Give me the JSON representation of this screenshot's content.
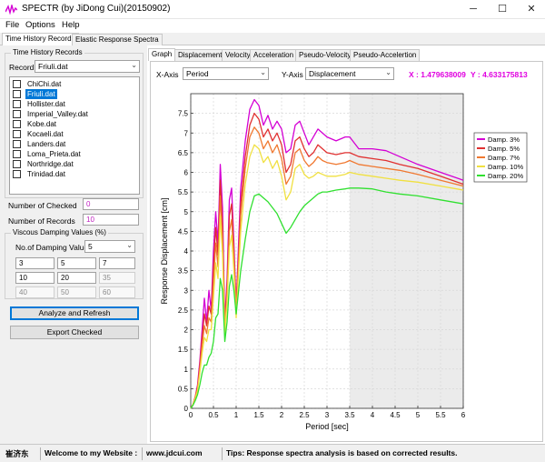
{
  "window": {
    "title": "SPECTR (by JiDong Cui)(20150902)",
    "minimize": "─",
    "maximize": "☐",
    "close": "✕"
  },
  "menu": [
    "File",
    "Options",
    "Help"
  ],
  "main_tabs": [
    "Time History Records",
    "Elastic Response Spectra"
  ],
  "left": {
    "group_title": "Time History Records",
    "record_label": "Record",
    "record_value": "Friuli.dat",
    "files": [
      "ChiChi.dat",
      "Friuli.dat",
      "Hollister.dat",
      "Imperial_Valley.dat",
      "Kobe.dat",
      "Kocaeli.dat",
      "Landers.dat",
      "Loma_Prieta.dat",
      "Northridge.dat",
      "Trinidad.dat"
    ],
    "selected_file_index": 1,
    "num_checked_label": "Number of Checked",
    "num_checked_value": "0",
    "num_records_label": "Number of Records",
    "num_records_value": "10",
    "damping_group_title": "Viscous Damping Values (%)",
    "num_damping_label": "No.of Damping Values",
    "num_damping_value": "5",
    "damping_inputs": [
      "3",
      "5",
      "7",
      "10",
      "20",
      "35",
      "40",
      "50",
      "60"
    ],
    "analyze_button": "Analyze and Refresh",
    "export_button": "Export Checked"
  },
  "graph_tabs": [
    "Graph",
    "Displacement",
    "Velocity",
    "Acceleration",
    "Pseudo-Velocity",
    "Pseudo-Accelertion"
  ],
  "axis_selectors": {
    "x_label": "X-Axis",
    "x_value": "Period",
    "y_label": "Y-Axis",
    "y_value": "Displacement"
  },
  "cursor": {
    "x": "X : 1.479638009",
    "y": "Y : 4.633175813"
  },
  "status": {
    "author": "崔济东",
    "welcome": "Welcome to my Website :",
    "website": "www.jdcui.com",
    "tips": "Tips: Response spectra analysis is based on corrected results."
  },
  "chart_data": {
    "type": "line",
    "xlabel": "Period [sec]",
    "ylabel": "Response Displacement [cm]",
    "xlim": [
      0,
      6
    ],
    "ylim": [
      0,
      8
    ],
    "xticks": [
      "0",
      "0.5",
      "1",
      "1.5",
      "2",
      "2.5",
      "3",
      "3.5",
      "4",
      "4.5",
      "5",
      "5.5",
      "6"
    ],
    "yticks": [
      "0",
      "0.5",
      "1",
      "1.5",
      "2",
      "2.5",
      "3",
      "3.5",
      "4",
      "4.5",
      "5",
      "5.5",
      "6",
      "6.5",
      "7",
      "7.5"
    ],
    "shaded_x_from": 3.5,
    "grid": true,
    "legend_position": "top-right",
    "series": [
      {
        "name": "Damp. 3%",
        "color": "#d400d4",
        "points": [
          [
            0,
            0
          ],
          [
            0.05,
            0.1
          ],
          [
            0.1,
            0.3
          ],
          [
            0.15,
            0.6
          ],
          [
            0.2,
            1.2
          ],
          [
            0.25,
            2.0
          ],
          [
            0.3,
            2.8
          ],
          [
            0.35,
            2.2
          ],
          [
            0.4,
            3.0
          ],
          [
            0.45,
            2.5
          ],
          [
            0.5,
            4.0
          ],
          [
            0.55,
            5.0
          ],
          [
            0.6,
            4.2
          ],
          [
            0.65,
            6.2
          ],
          [
            0.7,
            5.1
          ],
          [
            0.75,
            2.2
          ],
          [
            0.8,
            3.3
          ],
          [
            0.85,
            5.3
          ],
          [
            0.9,
            5.6
          ],
          [
            0.95,
            4.2
          ],
          [
            1.0,
            2.6
          ],
          [
            1.1,
            5.6
          ],
          [
            1.2,
            6.8
          ],
          [
            1.3,
            7.6
          ],
          [
            1.4,
            7.85
          ],
          [
            1.5,
            7.7
          ],
          [
            1.6,
            7.2
          ],
          [
            1.7,
            7.45
          ],
          [
            1.8,
            7.1
          ],
          [
            1.9,
            7.3
          ],
          [
            2.0,
            7.1
          ],
          [
            2.1,
            6.5
          ],
          [
            2.2,
            6.6
          ],
          [
            2.3,
            7.2
          ],
          [
            2.4,
            7.3
          ],
          [
            2.5,
            7.0
          ],
          [
            2.6,
            6.7
          ],
          [
            2.7,
            6.9
          ],
          [
            2.8,
            7.1
          ],
          [
            2.9,
            7.0
          ],
          [
            3.0,
            6.9
          ],
          [
            3.2,
            6.8
          ],
          [
            3.4,
            6.9
          ],
          [
            3.5,
            6.9
          ],
          [
            3.7,
            6.6
          ],
          [
            4.0,
            6.6
          ],
          [
            4.3,
            6.55
          ],
          [
            4.6,
            6.4
          ],
          [
            5.0,
            6.2
          ],
          [
            5.5,
            6.0
          ],
          [
            6.0,
            5.8
          ]
        ]
      },
      {
        "name": "Damp. 5%",
        "color": "#e03030",
        "points": [
          [
            0,
            0
          ],
          [
            0.05,
            0.1
          ],
          [
            0.1,
            0.3
          ],
          [
            0.15,
            0.55
          ],
          [
            0.2,
            1.1
          ],
          [
            0.25,
            1.8
          ],
          [
            0.3,
            2.4
          ],
          [
            0.35,
            2.1
          ],
          [
            0.4,
            2.6
          ],
          [
            0.45,
            2.4
          ],
          [
            0.5,
            3.6
          ],
          [
            0.55,
            4.6
          ],
          [
            0.6,
            3.9
          ],
          [
            0.65,
            5.8
          ],
          [
            0.7,
            4.6
          ],
          [
            0.75,
            2.1
          ],
          [
            0.8,
            3.1
          ],
          [
            0.85,
            4.9
          ],
          [
            0.9,
            5.2
          ],
          [
            0.95,
            4.0
          ],
          [
            1.0,
            2.5
          ],
          [
            1.1,
            5.2
          ],
          [
            1.2,
            6.4
          ],
          [
            1.3,
            7.2
          ],
          [
            1.4,
            7.5
          ],
          [
            1.5,
            7.35
          ],
          [
            1.6,
            6.9
          ],
          [
            1.7,
            7.1
          ],
          [
            1.8,
            6.8
          ],
          [
            1.9,
            7.0
          ],
          [
            2.0,
            6.7
          ],
          [
            2.1,
            6.0
          ],
          [
            2.2,
            6.2
          ],
          [
            2.3,
            6.8
          ],
          [
            2.4,
            6.9
          ],
          [
            2.5,
            6.6
          ],
          [
            2.6,
            6.4
          ],
          [
            2.7,
            6.5
          ],
          [
            2.8,
            6.7
          ],
          [
            2.9,
            6.6
          ],
          [
            3.0,
            6.5
          ],
          [
            3.2,
            6.45
          ],
          [
            3.4,
            6.5
          ],
          [
            3.5,
            6.5
          ],
          [
            3.7,
            6.4
          ],
          [
            4.0,
            6.35
          ],
          [
            4.3,
            6.3
          ],
          [
            4.6,
            6.2
          ],
          [
            5.0,
            6.1
          ],
          [
            5.5,
            5.9
          ],
          [
            6.0,
            5.7
          ]
        ]
      },
      {
        "name": "Damp. 7%",
        "color": "#f07830",
        "points": [
          [
            0,
            0
          ],
          [
            0.05,
            0.1
          ],
          [
            0.1,
            0.3
          ],
          [
            0.15,
            0.5
          ],
          [
            0.2,
            1.0
          ],
          [
            0.25,
            1.6
          ],
          [
            0.3,
            2.1
          ],
          [
            0.35,
            1.9
          ],
          [
            0.4,
            2.3
          ],
          [
            0.45,
            2.2
          ],
          [
            0.5,
            3.2
          ],
          [
            0.55,
            4.2
          ],
          [
            0.6,
            3.6
          ],
          [
            0.65,
            5.4
          ],
          [
            0.7,
            4.3
          ],
          [
            0.75,
            2.0
          ],
          [
            0.8,
            2.9
          ],
          [
            0.85,
            4.5
          ],
          [
            0.9,
            4.8
          ],
          [
            0.95,
            3.8
          ],
          [
            1.0,
            2.4
          ],
          [
            1.1,
            4.9
          ],
          [
            1.2,
            6.1
          ],
          [
            1.3,
            6.9
          ],
          [
            1.4,
            7.15
          ],
          [
            1.5,
            7.0
          ],
          [
            1.6,
            6.6
          ],
          [
            1.7,
            6.8
          ],
          [
            1.8,
            6.5
          ],
          [
            1.9,
            6.7
          ],
          [
            2.0,
            6.35
          ],
          [
            2.1,
            5.7
          ],
          [
            2.2,
            5.9
          ],
          [
            2.3,
            6.5
          ],
          [
            2.4,
            6.6
          ],
          [
            2.5,
            6.3
          ],
          [
            2.6,
            6.15
          ],
          [
            2.7,
            6.25
          ],
          [
            2.8,
            6.4
          ],
          [
            2.9,
            6.3
          ],
          [
            3.0,
            6.25
          ],
          [
            3.2,
            6.2
          ],
          [
            3.4,
            6.25
          ],
          [
            3.5,
            6.3
          ],
          [
            3.7,
            6.2
          ],
          [
            4.0,
            6.15
          ],
          [
            4.3,
            6.1
          ],
          [
            4.6,
            6.05
          ],
          [
            5.0,
            5.95
          ],
          [
            5.5,
            5.8
          ],
          [
            6.0,
            5.65
          ]
        ]
      },
      {
        "name": "Damp. 10%",
        "color": "#f0e040",
        "points": [
          [
            0,
            0
          ],
          [
            0.05,
            0.1
          ],
          [
            0.1,
            0.25
          ],
          [
            0.15,
            0.45
          ],
          [
            0.2,
            0.9
          ],
          [
            0.25,
            1.4
          ],
          [
            0.3,
            1.8
          ],
          [
            0.35,
            1.7
          ],
          [
            0.4,
            2.0
          ],
          [
            0.45,
            2.0
          ],
          [
            0.5,
            2.8
          ],
          [
            0.55,
            3.7
          ],
          [
            0.6,
            3.3
          ],
          [
            0.65,
            4.9
          ],
          [
            0.7,
            3.9
          ],
          [
            0.75,
            1.9
          ],
          [
            0.8,
            2.7
          ],
          [
            0.85,
            4.1
          ],
          [
            0.9,
            4.4
          ],
          [
            0.95,
            3.5
          ],
          [
            1.0,
            2.3
          ],
          [
            1.1,
            4.5
          ],
          [
            1.2,
            5.7
          ],
          [
            1.3,
            6.4
          ],
          [
            1.4,
            6.7
          ],
          [
            1.5,
            6.6
          ],
          [
            1.6,
            6.25
          ],
          [
            1.7,
            6.4
          ],
          [
            1.8,
            6.1
          ],
          [
            1.9,
            6.3
          ],
          [
            2.0,
            5.9
          ],
          [
            2.1,
            5.3
          ],
          [
            2.2,
            5.5
          ],
          [
            2.3,
            6.1
          ],
          [
            2.4,
            6.2
          ],
          [
            2.5,
            5.95
          ],
          [
            2.6,
            5.85
          ],
          [
            2.7,
            5.9
          ],
          [
            2.8,
            6.0
          ],
          [
            2.9,
            5.95
          ],
          [
            3.0,
            5.9
          ],
          [
            3.2,
            5.9
          ],
          [
            3.4,
            5.95
          ],
          [
            3.5,
            6.0
          ],
          [
            3.7,
            5.95
          ],
          [
            4.0,
            5.9
          ],
          [
            4.3,
            5.85
          ],
          [
            4.6,
            5.8
          ],
          [
            5.0,
            5.75
          ],
          [
            5.5,
            5.65
          ],
          [
            6.0,
            5.55
          ]
        ]
      },
      {
        "name": "Damp. 20%",
        "color": "#30e030",
        "points": [
          [
            0,
            0
          ],
          [
            0.05,
            0.08
          ],
          [
            0.1,
            0.2
          ],
          [
            0.15,
            0.35
          ],
          [
            0.2,
            0.6
          ],
          [
            0.25,
            0.9
          ],
          [
            0.3,
            1.1
          ],
          [
            0.35,
            1.1
          ],
          [
            0.4,
            1.3
          ],
          [
            0.45,
            1.4
          ],
          [
            0.5,
            1.7
          ],
          [
            0.55,
            2.3
          ],
          [
            0.6,
            2.4
          ],
          [
            0.65,
            3.3
          ],
          [
            0.7,
            3.0
          ],
          [
            0.75,
            1.7
          ],
          [
            0.8,
            2.2
          ],
          [
            0.85,
            3.1
          ],
          [
            0.9,
            3.4
          ],
          [
            0.95,
            3.0
          ],
          [
            1.0,
            2.4
          ],
          [
            1.1,
            3.5
          ],
          [
            1.2,
            4.3
          ],
          [
            1.3,
            5.0
          ],
          [
            1.4,
            5.4
          ],
          [
            1.5,
            5.45
          ],
          [
            1.6,
            5.35
          ],
          [
            1.7,
            5.25
          ],
          [
            1.8,
            5.1
          ],
          [
            1.9,
            4.95
          ],
          [
            2.0,
            4.7
          ],
          [
            2.1,
            4.45
          ],
          [
            2.2,
            4.6
          ],
          [
            2.3,
            4.8
          ],
          [
            2.4,
            5.0
          ],
          [
            2.5,
            5.15
          ],
          [
            2.6,
            5.25
          ],
          [
            2.7,
            5.35
          ],
          [
            2.8,
            5.45
          ],
          [
            2.9,
            5.5
          ],
          [
            3.0,
            5.5
          ],
          [
            3.2,
            5.55
          ],
          [
            3.4,
            5.58
          ],
          [
            3.5,
            5.6
          ],
          [
            3.7,
            5.6
          ],
          [
            4.0,
            5.58
          ],
          [
            4.3,
            5.5
          ],
          [
            4.6,
            5.45
          ],
          [
            5.0,
            5.4
          ],
          [
            5.5,
            5.3
          ],
          [
            6.0,
            5.2
          ]
        ]
      }
    ]
  }
}
